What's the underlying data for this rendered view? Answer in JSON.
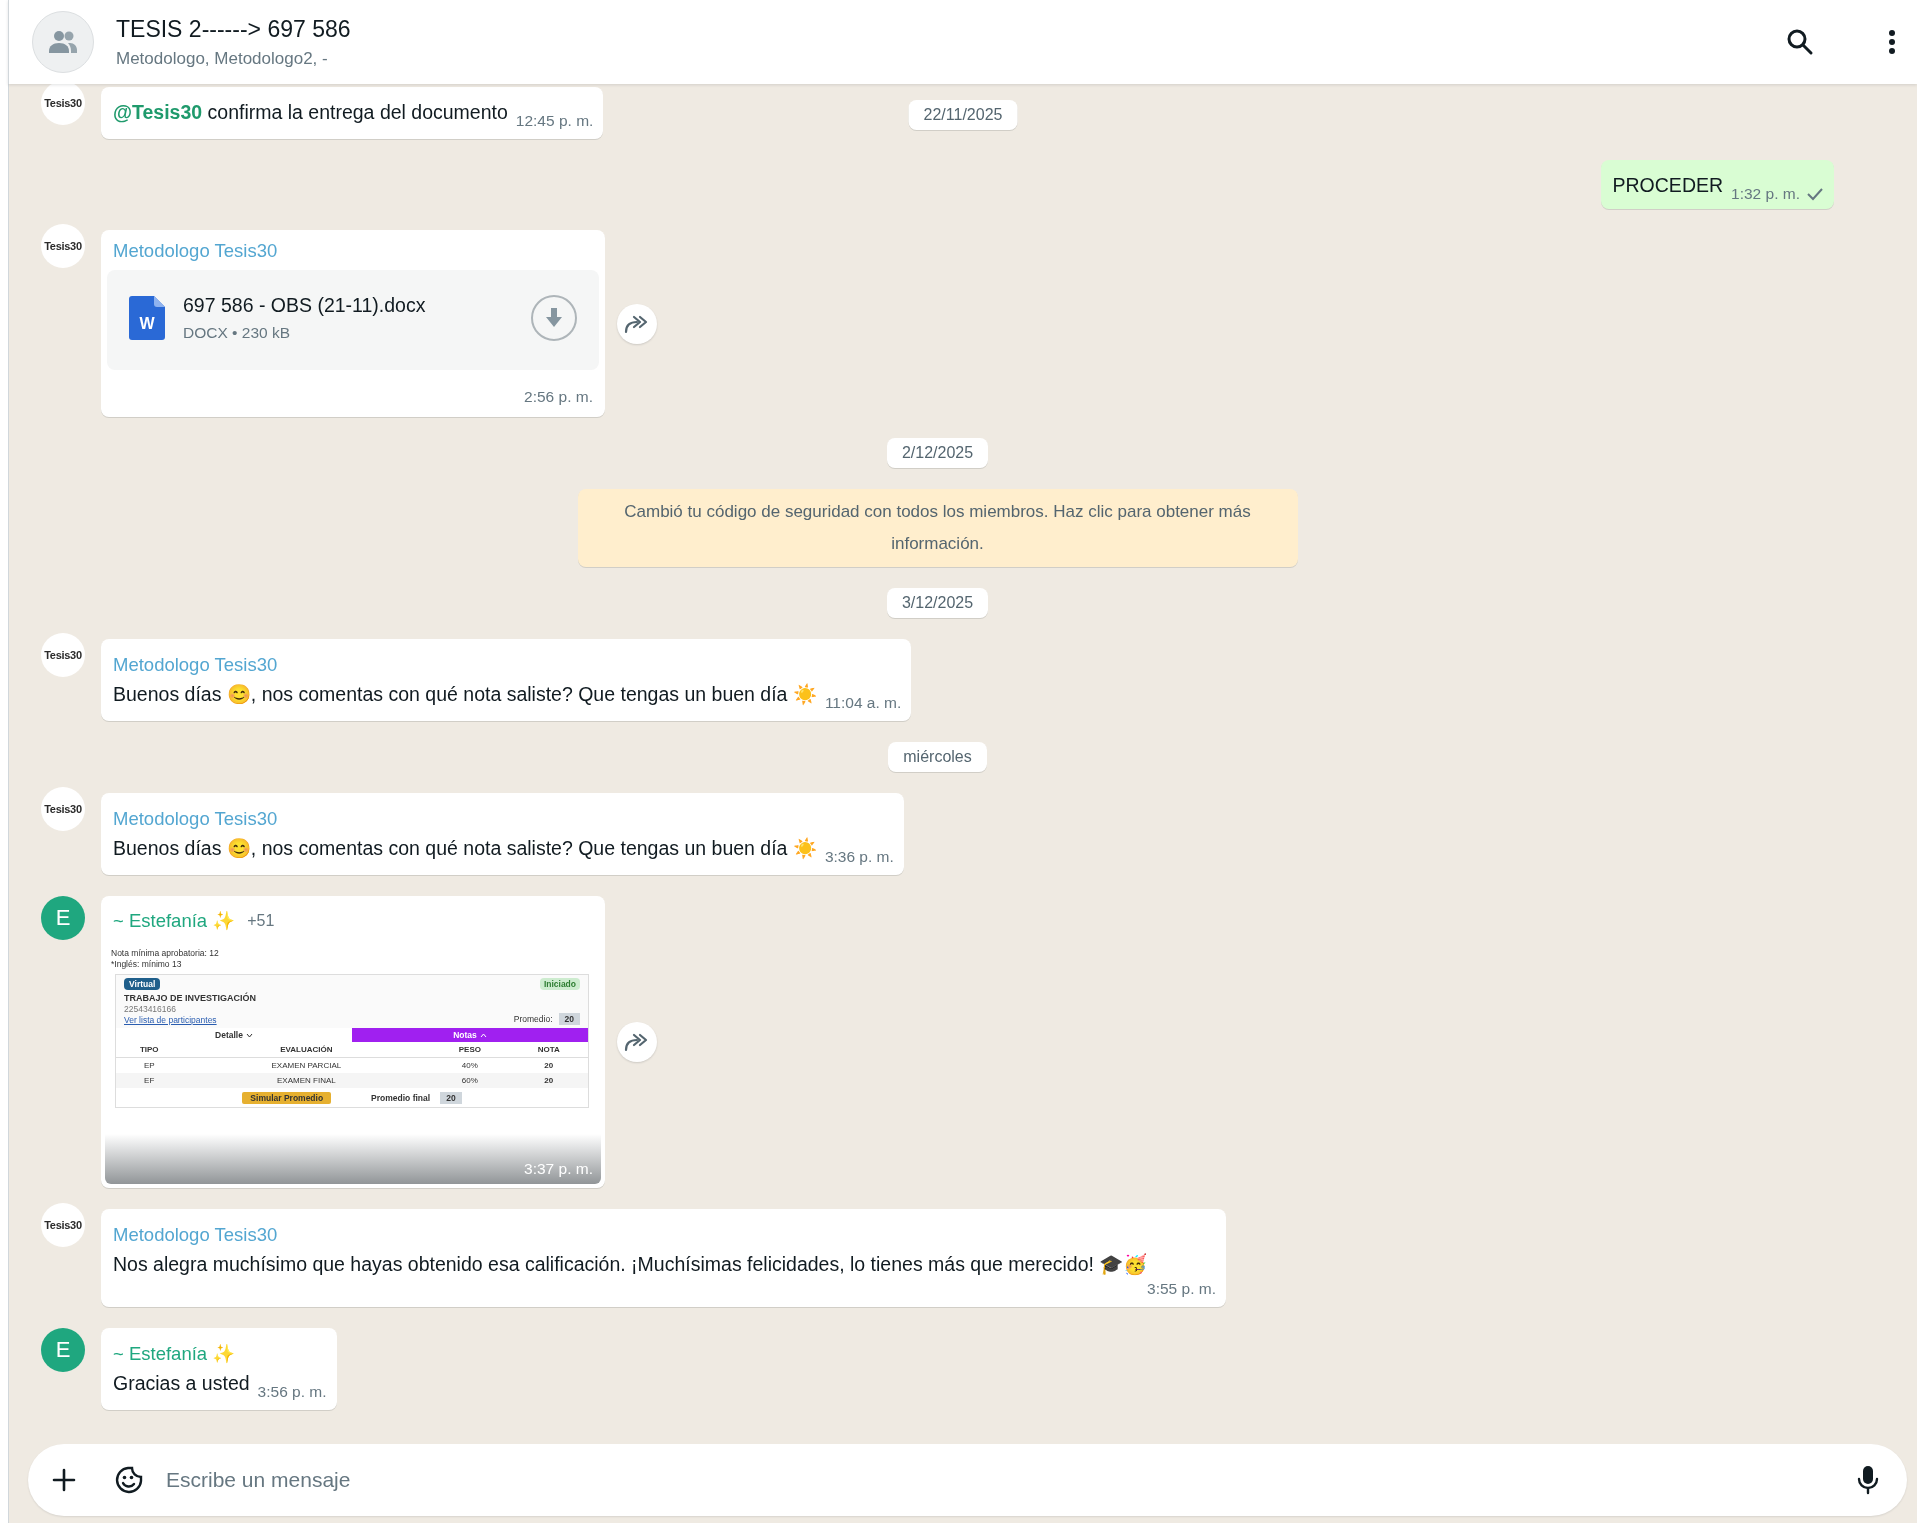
{
  "header": {
    "title": "TESIS 2------> 697 586",
    "subtitle": "Metodologo, Metodologo2, -"
  },
  "floating_date": "22/11/2025",
  "messages": [
    {
      "kind": "text",
      "outgoing": false,
      "avatar": {
        "kind": "logo",
        "label": "Tesis30"
      },
      "mention": "@Tesis30",
      "text": "confirma la entrega del documento",
      "time": "12:45 p. m."
    },
    {
      "kind": "text",
      "outgoing": true,
      "text": "PROCEDER",
      "time": "1:32 p. m.",
      "read": false
    },
    {
      "kind": "file",
      "avatar": {
        "kind": "logo",
        "label": "Tesis30"
      },
      "sender": "Metodologo Tesis30",
      "color": "#53a6d1",
      "file_icon_letter": "W",
      "file_name": "697 586 - OBS (21-11).docx",
      "file_info": "DOCX • 230 kB",
      "time": "2:56 p. m.",
      "forward": true
    },
    {
      "kind": "date",
      "text": "2/12/2025"
    },
    {
      "kind": "system",
      "text": "Cambió tu código de seguridad con todos los miembros. Haz clic para obtener más información."
    },
    {
      "kind": "date",
      "text": "3/12/2025"
    },
    {
      "kind": "text",
      "outgoing": false,
      "avatar": {
        "kind": "logo",
        "label": "Tesis30"
      },
      "sender": "Metodologo Tesis30",
      "color": "#53a6d1",
      "text": "Buenos días 😊, nos comentas con qué nota saliste? Que tengas un buen día ☀️",
      "time": "11:04 a. m."
    },
    {
      "kind": "date",
      "text": "miércoles"
    },
    {
      "kind": "text",
      "outgoing": false,
      "avatar": {
        "kind": "logo",
        "label": "Tesis30"
      },
      "sender": "Metodologo Tesis30",
      "color": "#53a6d1",
      "text": "Buenos días 😊, nos comentas con qué nota saliste? Que tengas un buen día ☀️",
      "time": "3:36 p. m."
    },
    {
      "kind": "image",
      "avatar": {
        "kind": "letter",
        "label": "E"
      },
      "sender": "~ Estefanía ✨",
      "color": "#1fa77f",
      "sender_phone": "+51",
      "time": "3:37 p. m.",
      "forward": true,
      "screenshot": {
        "notes": [
          "Nota mínima aprobatoria: 12",
          "*Inglés: mínimo 13"
        ],
        "badge": "Virtual",
        "status": "Iniciado",
        "course": "TRABAJO DE INVESTIGACIÓN",
        "code": "22543416166",
        "link": "Ver lista de participantes",
        "average_label": "Promedio:",
        "average": "20",
        "tabs": [
          {
            "label": "Detalle",
            "selected": false
          },
          {
            "label": "Notas",
            "selected": true
          }
        ],
        "columns": [
          "TIPO",
          "EVALUACIÓN",
          "PESO",
          "NOTA"
        ],
        "rows": [
          [
            "EP",
            "EXAMEN PARCIAL",
            "40%",
            "20"
          ],
          [
            "EF",
            "EXAMEN FINAL",
            "60%",
            "20"
          ]
        ],
        "button": "Simular Promedio",
        "final_label": "Promedio final",
        "final": "20"
      }
    },
    {
      "kind": "text",
      "outgoing": false,
      "avatar": {
        "kind": "logo",
        "label": "Tesis30"
      },
      "sender": "Metodologo Tesis30",
      "color": "#53a6d1",
      "text": "Nos alegra muchísimo que hayas obtenido esa calificación. ¡Muchísimas felicidades, lo tienes más que merecido! 🎓🥳",
      "time": "3:55 p. m."
    },
    {
      "kind": "text",
      "outgoing": false,
      "avatar": {
        "kind": "letter",
        "label": "E"
      },
      "sender": "~ Estefanía ✨",
      "color": "#1fa77f",
      "text": "Gracias a usted",
      "time": "3:56 p. m."
    }
  ],
  "composer": {
    "placeholder": "Escribe un mensaje"
  }
}
